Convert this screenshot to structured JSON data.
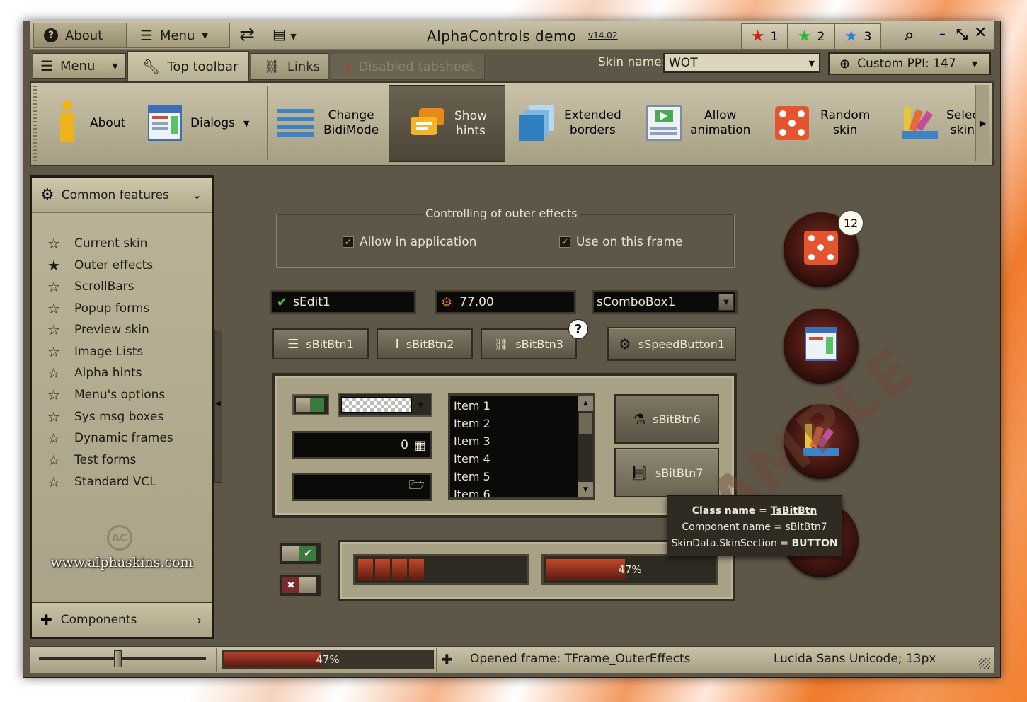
{
  "window": {
    "title": "AlphaControls demo",
    "version": "v14.02",
    "about_label": "About",
    "menu_label": "Menu",
    "star_buttons": [
      {
        "label": "1",
        "color": "#d32020"
      },
      {
        "label": "2",
        "color": "#2db52d"
      },
      {
        "label": "3",
        "color": "#2f7fd8"
      }
    ]
  },
  "tabs": {
    "menu_label": "Menu",
    "items": [
      {
        "label": "Top toolbar"
      },
      {
        "label": "Links"
      },
      {
        "label": "Disabled tabsheet"
      }
    ],
    "skin_name_label": "Skin name:",
    "skin_name_value": "WOT",
    "custom_ppi_label": "Custom PPI: 147"
  },
  "toolbar": {
    "items": [
      {
        "line1": "About",
        "line2": ""
      },
      {
        "line1": "Dialogs",
        "line2": ""
      },
      {
        "line1": "Change",
        "line2": "BidiMode"
      },
      {
        "line1": "Show",
        "line2": "hints"
      },
      {
        "line1": "Extended",
        "line2": "borders"
      },
      {
        "line1": "Allow",
        "line2": "animation"
      },
      {
        "line1": "Random",
        "line2": "skin"
      },
      {
        "line1": "Selec",
        "line2": "skin"
      }
    ]
  },
  "sidebar": {
    "header": "Common features",
    "items": [
      {
        "label": "Current skin"
      },
      {
        "label": "Outer effects"
      },
      {
        "label": "ScrollBars"
      },
      {
        "label": "Popup forms"
      },
      {
        "label": "Preview skin"
      },
      {
        "label": "Image Lists"
      },
      {
        "label": "Alpha hints"
      },
      {
        "label": "Menu's options"
      },
      {
        "label": "Sys msg boxes"
      },
      {
        "label": "Dynamic frames"
      },
      {
        "label": "Test forms"
      },
      {
        "label": "Standard VCL"
      }
    ],
    "website": "www.alphaskins.com",
    "footer": "Components"
  },
  "content": {
    "group_title": "Controlling of outer effects",
    "check_app": "Allow in application",
    "check_frame": "Use on this frame",
    "edit1": "sEdit1",
    "spin_value": "77.00",
    "combo": "sComboBox1",
    "btn1": "sBitBtn1",
    "btn2": "sBitBtn2",
    "btn3": "sBitBtn3",
    "speed_btn": "sSpeedButton1",
    "calc_value": "0",
    "list_items": [
      "Item 1",
      "Item 2",
      "Item 3",
      "Item 4",
      "Item 5",
      "Item 6"
    ],
    "btn6": "sBitBtn6",
    "btn7": "sBitBtn7",
    "progress_label": "47%",
    "progress_fraction": 0.47,
    "badge": "12",
    "question_mark": "?",
    "watermark": "SAMPLE"
  },
  "hint": {
    "line1_prefix": "Class name = ",
    "line1_value": "TsBitBtn",
    "line2": "Component name = sBitBtn7",
    "line3_prefix": "SkinData.SkinSection = ",
    "line3_value": "BUTTON"
  },
  "status": {
    "progress_label": "47%",
    "progress_fraction": 0.47,
    "opened_frame": "Opened frame: TFrame_OuterEffects",
    "font_info": "Lucida Sans Unicode; 13px"
  }
}
